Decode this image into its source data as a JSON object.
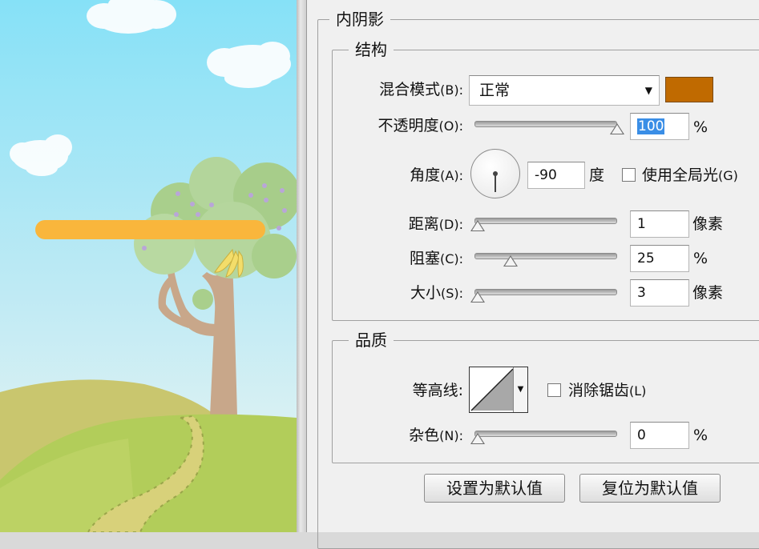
{
  "inner_shadow": {
    "title": "内阴影",
    "structure": {
      "title": "结构",
      "blend_mode": {
        "label": "混合模式",
        "key": "(B):",
        "value": "正常",
        "color": "#c06a00"
      },
      "opacity": {
        "label": "不透明度",
        "key": "(O):",
        "value": "100",
        "unit": "%",
        "level": 1.0
      },
      "angle": {
        "label": "角度",
        "key": "(A):",
        "value": "-90",
        "unit": "度",
        "global_light_label": "使用全局光",
        "global_light_key": "(G)",
        "global_light_checked": false
      },
      "distance": {
        "label": "距离",
        "key": "(D):",
        "value": "1",
        "unit": "像素",
        "level": 0.0
      },
      "choke": {
        "label": "阻塞",
        "key": "(C):",
        "value": "25",
        "unit": "%",
        "level": 0.25
      },
      "size": {
        "label": "大小",
        "key": "(S):",
        "value": "3",
        "unit": "像素",
        "level": 0.02
      }
    },
    "quality": {
      "title": "品质",
      "contour": {
        "label": "等高线",
        "key": ":"
      },
      "anti_alias": {
        "label": "消除锯齿",
        "key": "(L)",
        "checked": false
      },
      "noise": {
        "label": "杂色",
        "key": "(N):",
        "value": "0",
        "unit": "%",
        "level": 0.0
      }
    },
    "buttons": {
      "set_default": "设置为默认值",
      "reset_default": "复位为默认值"
    }
  },
  "colors": {
    "sky_top": "#89e3f7",
    "sky_bottom": "#e9f6f5",
    "bar": "#f9b63c",
    "hill": "#a9c94a"
  }
}
